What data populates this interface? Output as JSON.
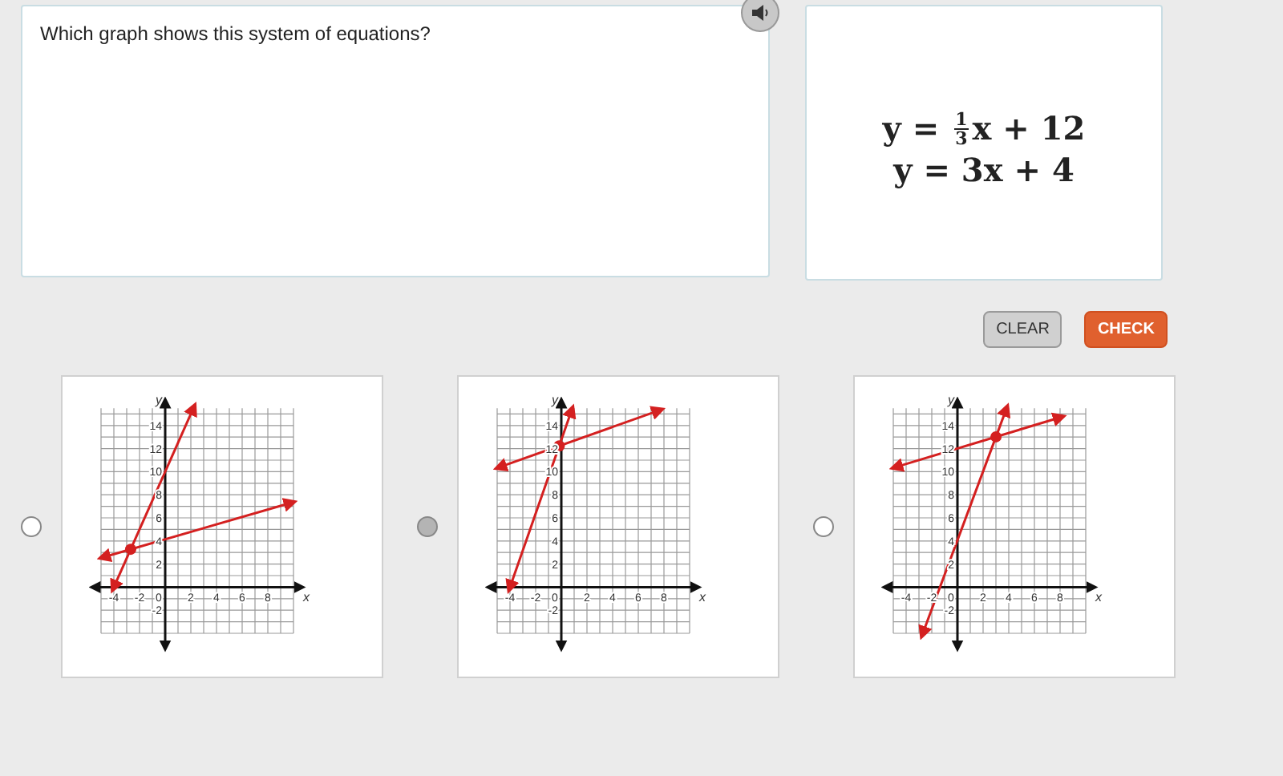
{
  "question": {
    "text": "Which graph shows this system of equations?"
  },
  "equations": [
    {
      "kind": "fraction",
      "before": "y = ",
      "numerator": "1",
      "denominator": "3",
      "after": "x + 12"
    },
    {
      "kind": "plain",
      "text": "y = 3x + 4"
    }
  ],
  "buttons": [
    {
      "label": "CLEAR",
      "kind": "secondary"
    },
    {
      "label": "CHECK",
      "kind": "primary"
    }
  ],
  "choices": [
    {
      "selected": false,
      "chart_data": {
        "type": "line",
        "grid": true,
        "xlabel": "x",
        "ylabel": "y",
        "xlim": [
          -5,
          10
        ],
        "ylim": [
          -4,
          16
        ],
        "xticks": [
          -4,
          -2,
          0,
          2,
          4,
          6,
          8
        ],
        "yticks": [
          -2,
          2,
          4,
          6,
          8,
          10,
          12,
          14
        ],
        "series": [
          {
            "color": "#d42020",
            "x": [
              -4,
              2.2
            ],
            "values": [
              0,
              15.5
            ]
          },
          {
            "color": "#d42020",
            "x": [
              -4.8,
              9.8
            ],
            "values": [
              2.6,
              7.3
            ]
          }
        ]
      }
    },
    {
      "selected": true,
      "chart_data": {
        "type": "line",
        "grid": true,
        "xlabel": "x",
        "ylabel": "y",
        "xlim": [
          -5,
          10
        ],
        "ylim": [
          -4,
          16
        ],
        "xticks": [
          -4,
          -2,
          0,
          2,
          4,
          6,
          8
        ],
        "yticks": [
          -2,
          2,
          4,
          6,
          8,
          10,
          12,
          14
        ],
        "series": [
          {
            "color": "#d42020",
            "x": [
              -4,
              0.8
            ],
            "values": [
              0,
              15.3
            ]
          },
          {
            "color": "#d42020",
            "x": [
              -4.8,
              7.6
            ],
            "values": [
              10.4,
              15.3
            ]
          }
        ]
      }
    },
    {
      "selected": false,
      "chart_data": {
        "type": "line",
        "grid": true,
        "xlabel": "x",
        "ylabel": "y",
        "xlim": [
          -5,
          10
        ],
        "ylim": [
          -4,
          16
        ],
        "xticks": [
          -4,
          -2,
          0,
          2,
          4,
          6,
          8
        ],
        "yticks": [
          -2,
          2,
          4,
          6,
          8,
          10,
          12,
          14
        ],
        "series": [
          {
            "color": "#d42020",
            "x": [
              -2.7,
              3.8
            ],
            "values": [
              -4,
              15.4
            ]
          },
          {
            "color": "#d42020",
            "x": [
              -4.8,
              8
            ],
            "values": [
              10.4,
              14.7
            ]
          }
        ]
      }
    }
  ]
}
